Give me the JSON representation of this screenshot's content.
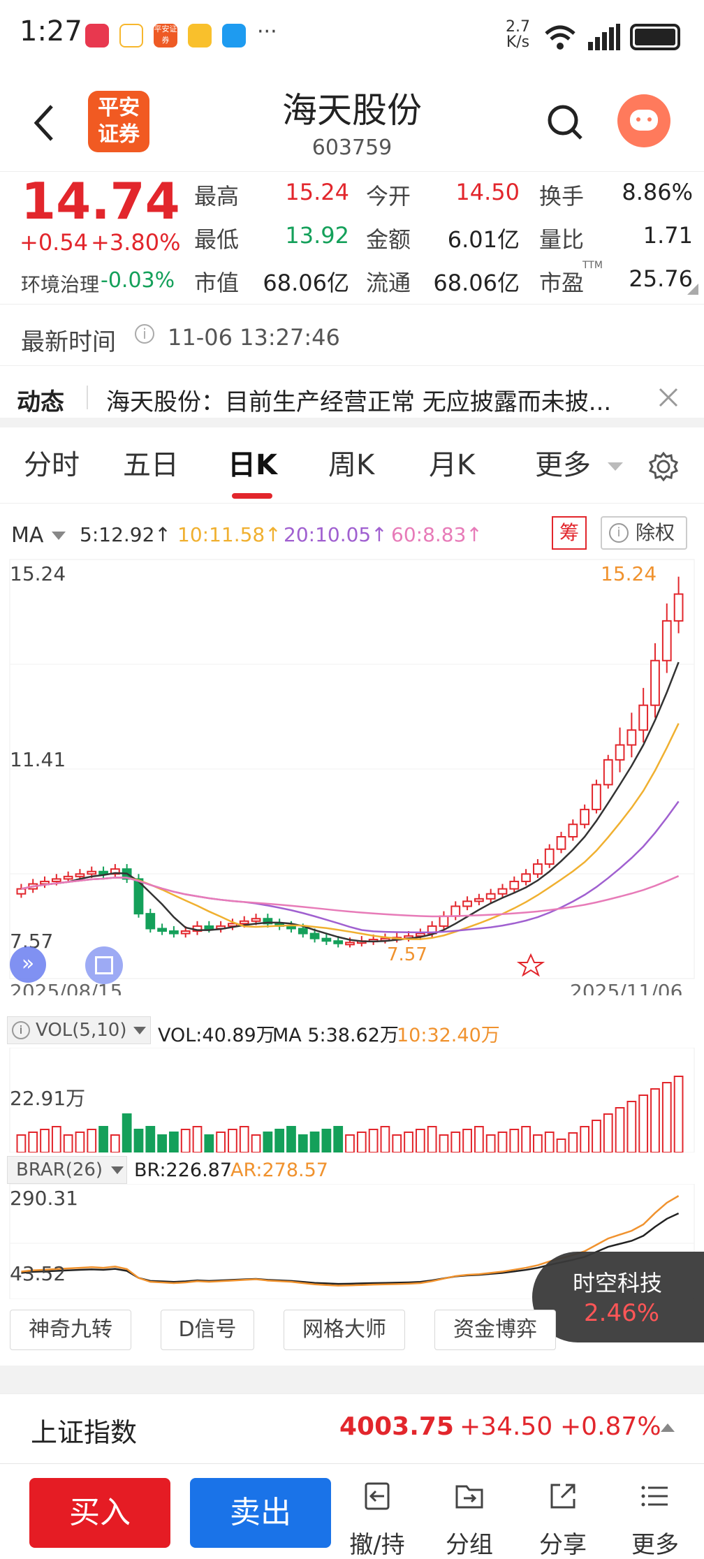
{
  "status_bar": {
    "time": "1:27",
    "net_speed_top": "2.7",
    "net_speed_bottom": "K/s",
    "more": "···",
    "app_icons": [
      "huawei-app-icon",
      "smile-app-icon",
      "pingan-app-icon",
      "weibo-app-icon",
      "message-app-icon"
    ],
    "pingan_icon_text": "平安证券"
  },
  "header": {
    "title": "海天股份",
    "code": "603759",
    "logo_text_1": "平安",
    "logo_text_2": "证券"
  },
  "quote": {
    "price": "14.74",
    "change": "+0.54",
    "change_pct": "+3.80%",
    "sector_label": "环境治理",
    "sector_change": "-0.03%",
    "col1": [
      {
        "label": "最高",
        "value": "15.24",
        "color": "#e2262c"
      },
      {
        "label": "最低",
        "value": "13.92",
        "color": "#14a05a"
      },
      {
        "label": "市值",
        "value": "68.06亿",
        "color": "#222222"
      }
    ],
    "col2": [
      {
        "label": "今开",
        "value": "14.50",
        "color": "#e2262c"
      },
      {
        "label": "金额",
        "value": "6.01亿",
        "color": "#222222"
      },
      {
        "label": "流通",
        "value": "68.06亿",
        "color": "#222222"
      }
    ],
    "col3": [
      {
        "label": "换手",
        "value": "8.86%"
      },
      {
        "label": "量比",
        "value": "1.71"
      },
      {
        "label": "市盈",
        "value": "25.76",
        "sup": "TTM"
      }
    ]
  },
  "update": {
    "label": "最新时间",
    "value": "11-06 13:27:46"
  },
  "news": {
    "label": "动态",
    "text": "海天股份：目前生产经营正常 无应披露而未披..."
  },
  "tabs": [
    "分时",
    "五日",
    "日K",
    "周K",
    "月K",
    "更多"
  ],
  "active_tab": "日K",
  "ma_bar": {
    "label": "MA",
    "ma5": "5:12.92↑",
    "ma10": "10:11.58↑",
    "ma20": "20:10.05↑",
    "ma60": "60:8.83↑",
    "chip_btn": "筹",
    "right_btn": "除权"
  },
  "kline": {
    "y_top": "15.24",
    "y_mid": "11.41",
    "y_bot": "7.57",
    "high_marker": "15.24",
    "low_marker": "7.57",
    "date_start": "2025/08/15",
    "date_end": "2025/11/06"
  },
  "volume": {
    "indicator": "VOL(5,10)",
    "vol": "VOL:40.89万",
    "ma5": "MA 5:38.62万",
    "ma10": "10:32.40万",
    "y_label": "22.91万"
  },
  "brar": {
    "indicator": "BRAR(26)",
    "br": "BR:226.87",
    "ar": "AR:278.57",
    "y_top": "290.31",
    "y_bot": "43.52"
  },
  "float_card": {
    "name": "时空科技",
    "pct": "2.46%"
  },
  "tools": [
    "神奇九转",
    "D信号",
    "网格大师",
    "资金博弈"
  ],
  "index_bar": {
    "name": "上证指数",
    "value": "4003.75",
    "change": "+34.50",
    "pct": "+0.87%"
  },
  "bottom": {
    "buy": "买入",
    "sell": "卖出",
    "items": [
      "撤/持",
      "分组",
      "分享",
      "更多"
    ]
  },
  "colors": {
    "up": "#e2262c",
    "down": "#14a05a",
    "ma5": "#333333",
    "ma10": "#f0b030",
    "ma20": "#a060d0",
    "ma60": "#e77bb8",
    "buy": "#e51c24",
    "sell": "#1a73e8"
  },
  "chart_data": {
    "type": "candlestick",
    "x_range": [
      "2025/08/15",
      "2025/11/06"
    ],
    "ylim": [
      7.57,
      15.24
    ],
    "closes_est": [
      8.8,
      8.9,
      8.95,
      9.0,
      9.05,
      9.1,
      9.15,
      9.1,
      9.2,
      9.0,
      8.3,
      8.0,
      7.95,
      7.9,
      7.95,
      8.05,
      8.0,
      8.05,
      8.1,
      8.15,
      8.2,
      8.1,
      8.05,
      8.0,
      7.9,
      7.8,
      7.75,
      7.7,
      7.72,
      7.75,
      7.78,
      7.8,
      7.82,
      7.85,
      7.9,
      8.05,
      8.25,
      8.45,
      8.55,
      8.6,
      8.7,
      8.8,
      8.95,
      9.1,
      9.3,
      9.6,
      9.85,
      10.1,
      10.4,
      10.9,
      11.4,
      11.7,
      12.0,
      12.5,
      13.4,
      14.2,
      14.74
    ]
  }
}
